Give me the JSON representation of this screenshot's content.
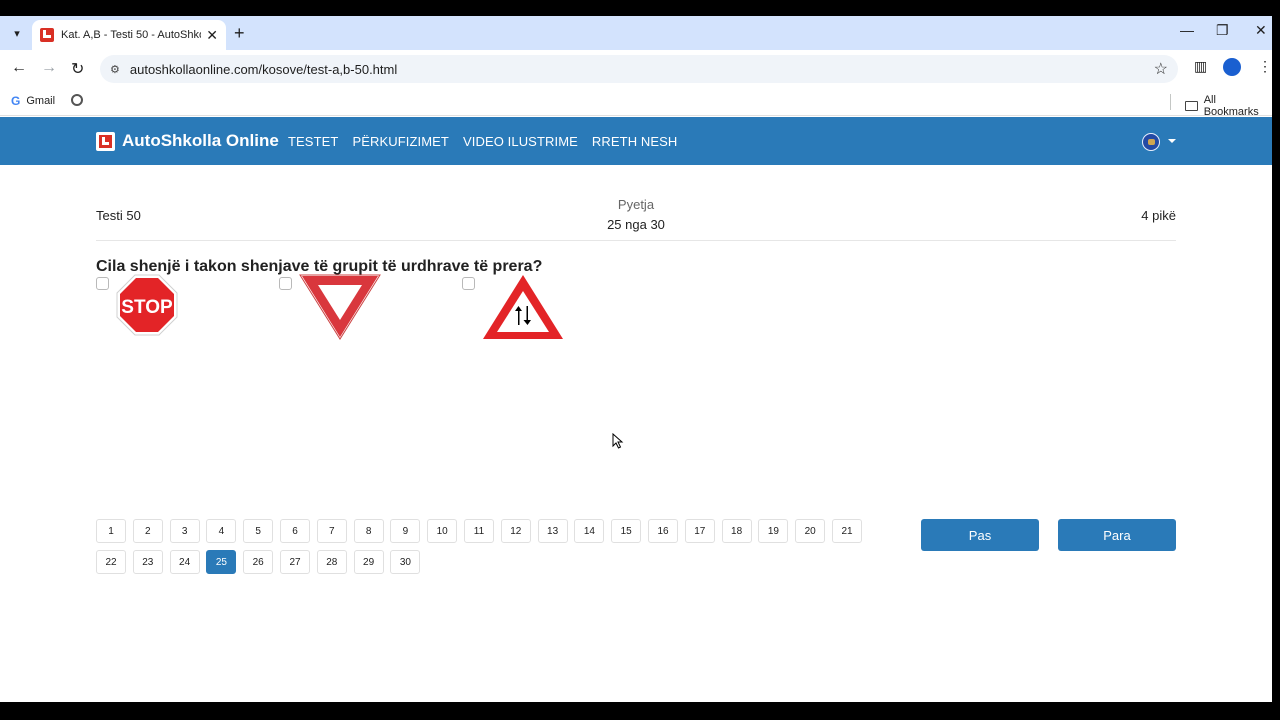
{
  "browser": {
    "tab_title": "Kat. A,B - Testi 50 - AutoShkolla Online",
    "url": "autoshkollaonline.com/kosove/test-a,b-50.html",
    "bookmarks": [
      "Gmail"
    ],
    "all_bookmarks_label": "All Bookmarks"
  },
  "site": {
    "brand": "AutoShkolla Online",
    "menu": [
      "TESTET",
      "PËRKUFIZIMET",
      "VIDEO ILUSTRIME",
      "RRETH NESH"
    ],
    "accent_color": "#2a7ab8"
  },
  "quiz": {
    "test_name": "Testi 50",
    "question_label": "Pyetja",
    "question_count": "25 nga 30",
    "points": "4 pikë",
    "question_text": "Cila shenjë i takon shenjave të grupit të urdhrave të prera?",
    "sign_stop_text": "STOP",
    "answers": [
      {
        "sign": "stop-sign",
        "checked": false
      },
      {
        "sign": "yield-sign",
        "checked": false
      },
      {
        "sign": "two-way-traffic-warning-sign",
        "checked": false
      }
    ]
  },
  "pagination": {
    "pages": [
      "1",
      "2",
      "3",
      "4",
      "5",
      "6",
      "7",
      "8",
      "9",
      "10",
      "11",
      "12",
      "13",
      "14",
      "15",
      "16",
      "17",
      "18",
      "19",
      "20",
      "21",
      "22",
      "23",
      "24",
      "25",
      "26",
      "27",
      "28",
      "29",
      "30"
    ],
    "current": "25",
    "prev_label": "Pas",
    "next_label": "Para"
  }
}
